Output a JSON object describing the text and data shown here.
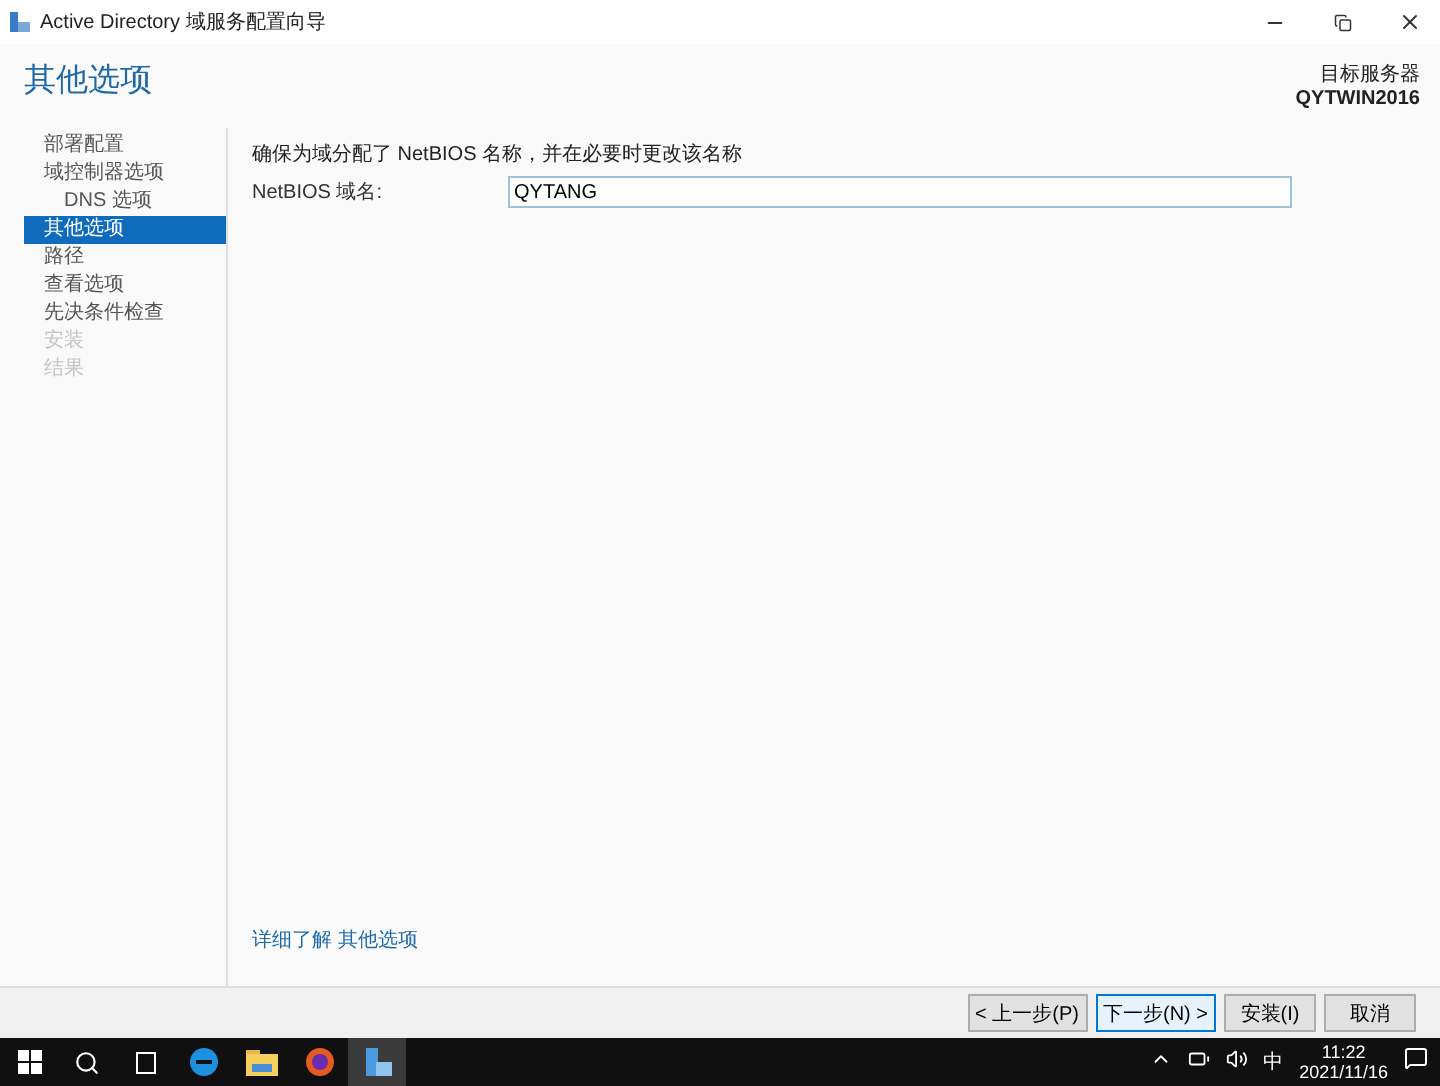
{
  "window": {
    "title": "Active Directory 域服务配置向导"
  },
  "header": {
    "title": "其他选项",
    "target_label": "目标服务器",
    "target_name": "QYTWIN2016"
  },
  "sidebar": {
    "items": [
      {
        "label": "部署配置",
        "selected": false,
        "disabled": false
      },
      {
        "label": "域控制器选项",
        "selected": false,
        "disabled": false,
        "children": [
          {
            "label": "DNS 选项",
            "selected": false,
            "disabled": false
          }
        ]
      },
      {
        "label": "其他选项",
        "selected": true,
        "disabled": false
      },
      {
        "label": "路径",
        "selected": false,
        "disabled": false
      },
      {
        "label": "查看选项",
        "selected": false,
        "disabled": false
      },
      {
        "label": "先决条件检查",
        "selected": false,
        "disabled": false
      },
      {
        "label": "安装",
        "selected": false,
        "disabled": true
      },
      {
        "label": "结果",
        "selected": false,
        "disabled": true
      }
    ]
  },
  "content": {
    "instruction": "确保为域分配了 NetBIOS 名称，并在必要时更改该名称",
    "field": {
      "label": "NetBIOS 域名:",
      "value": "QYTANG"
    },
    "link": "详细了解 其他选项"
  },
  "buttons": [
    {
      "label": "< 上一步(P)",
      "focused": false
    },
    {
      "label": "下一步(N) >",
      "focused": true
    },
    {
      "label": "安装(I)",
      "focused": false
    },
    {
      "label": "取消",
      "focused": false
    }
  ],
  "taskbar": {
    "tray": {
      "ime": "中",
      "time": "11:22",
      "date": "2021/11/16"
    }
  }
}
